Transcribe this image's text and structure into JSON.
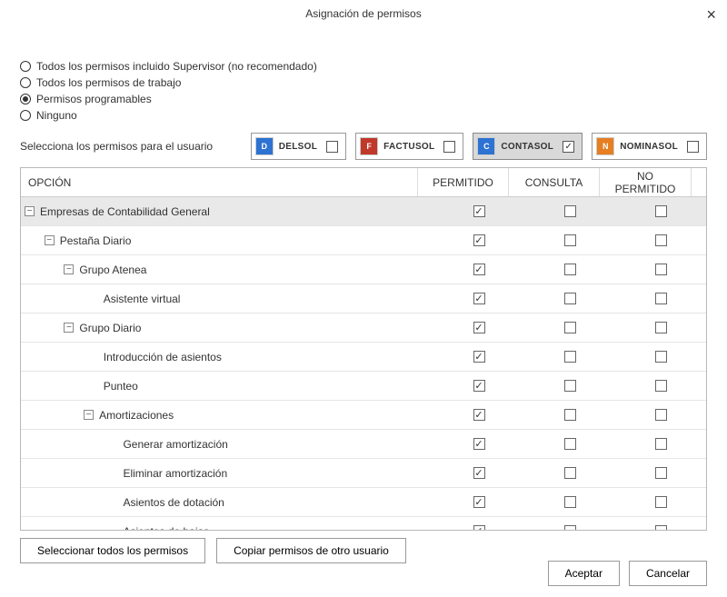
{
  "title": "Asignación de permisos",
  "radios": [
    {
      "label": "Todos los permisos incluido Supervisor (no recomendado)",
      "selected": false
    },
    {
      "label": "Todos los permisos de trabajo",
      "selected": false
    },
    {
      "label": "Permisos programables",
      "selected": true
    },
    {
      "label": "Ninguno",
      "selected": false
    }
  ],
  "select_label": "Selecciona los permisos para el usuario",
  "apps": [
    {
      "name": "DELSOL",
      "icon_text": "D",
      "icon_class": "delsol",
      "checked": false,
      "selected": false
    },
    {
      "name": "FACTUSOL",
      "icon_text": "F",
      "icon_class": "factusol",
      "checked": false,
      "selected": false
    },
    {
      "name": "CONTASOL",
      "icon_text": "C",
      "icon_class": "contasol",
      "checked": true,
      "selected": true
    },
    {
      "name": "NOMINASOL",
      "icon_text": "N",
      "icon_class": "nominasol",
      "checked": false,
      "selected": false
    }
  ],
  "columns": {
    "opcion": "OPCIÓN",
    "permitido": "PERMITIDO",
    "consulta": "CONSULTA",
    "no_permitido": "NO PERMITIDO"
  },
  "rows": [
    {
      "label": "Empresas de  Contabilidad General",
      "indent": 0,
      "toggle": "−",
      "permitido": true,
      "consulta": false,
      "no_permitido": false,
      "shaded": true
    },
    {
      "label": "Pestaña Diario",
      "indent": 1,
      "toggle": "−",
      "permitido": true,
      "consulta": false,
      "no_permitido": false
    },
    {
      "label": "Grupo Atenea",
      "indent": 2,
      "toggle": "−",
      "permitido": true,
      "consulta": false,
      "no_permitido": false
    },
    {
      "label": "Asistente virtual",
      "indent": 3,
      "toggle": null,
      "permitido": true,
      "consulta": false,
      "no_permitido": false
    },
    {
      "label": "Grupo Diario",
      "indent": 2,
      "toggle": "−",
      "permitido": true,
      "consulta": false,
      "no_permitido": false
    },
    {
      "label": "Introducción de asientos",
      "indent": 3,
      "toggle": null,
      "permitido": true,
      "consulta": false,
      "no_permitido": false
    },
    {
      "label": "Punteo",
      "indent": 3,
      "toggle": null,
      "permitido": true,
      "consulta": false,
      "no_permitido": false
    },
    {
      "label": "Amortizaciones",
      "indent": 3,
      "toggle": "−",
      "permitido": true,
      "consulta": false,
      "no_permitido": false
    },
    {
      "label": "Generar amortización",
      "indent": 4,
      "toggle": null,
      "permitido": true,
      "consulta": false,
      "no_permitido": false
    },
    {
      "label": "Eliminar amortización",
      "indent": 4,
      "toggle": null,
      "permitido": true,
      "consulta": false,
      "no_permitido": false
    },
    {
      "label": "Asientos de dotación",
      "indent": 4,
      "toggle": null,
      "permitido": true,
      "consulta": false,
      "no_permitido": false
    },
    {
      "label": "Asientos de bajas",
      "indent": 4,
      "toggle": null,
      "permitido": true,
      "consulta": false,
      "no_permitido": false
    }
  ],
  "bottom_buttons": {
    "select_all": "Seleccionar todos los permisos",
    "copy": "Copiar permisos de otro usuario"
  },
  "footer": {
    "accept": "Aceptar",
    "cancel": "Cancelar"
  },
  "checkmark": "✓"
}
